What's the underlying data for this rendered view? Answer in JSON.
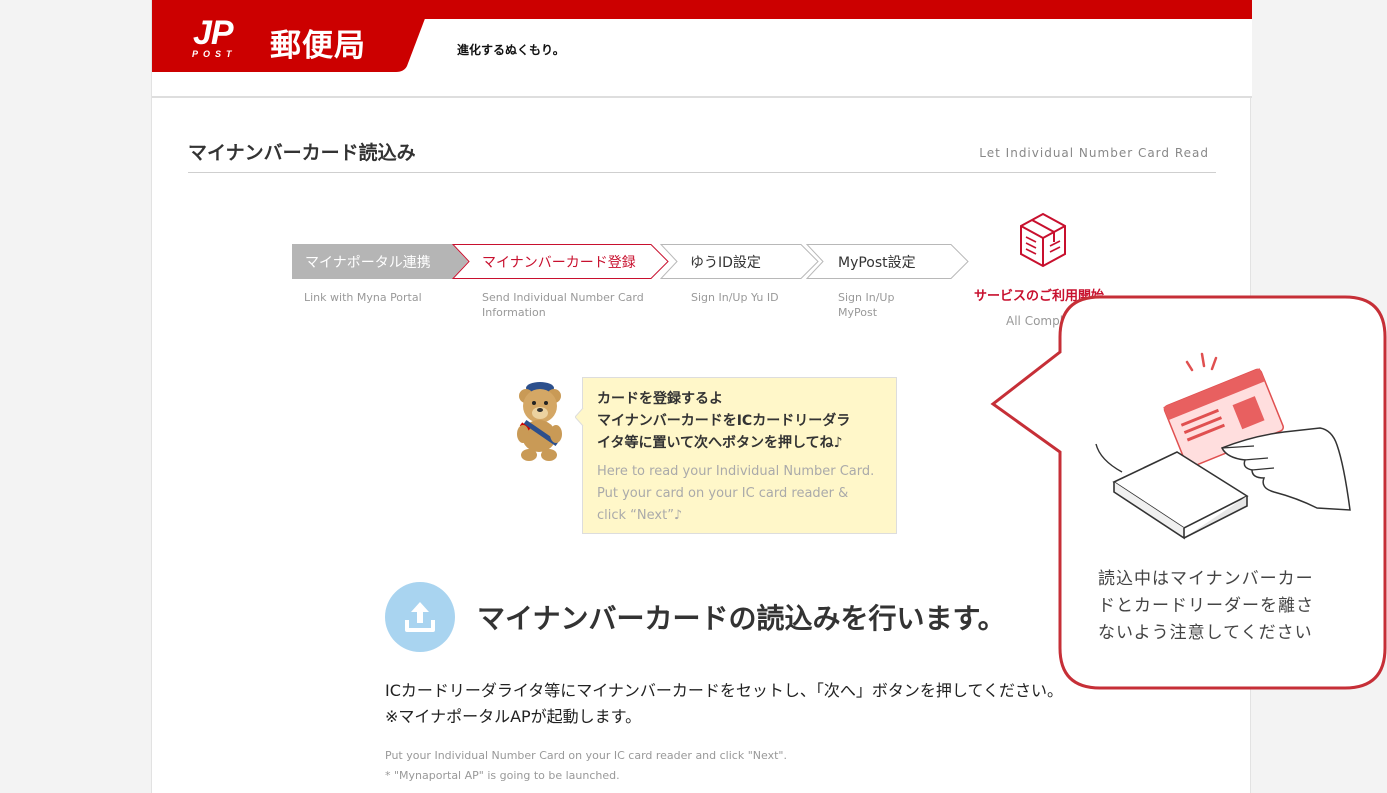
{
  "header": {
    "logo_mark": "JP",
    "logo_post": "POST",
    "logo_text": "郵便局",
    "tagline": "進化するぬくもり。"
  },
  "colors": {
    "brand_red": "#cc0000",
    "step_done_bg": "#b5b5b5",
    "accent_red": "#c8102e",
    "hint_bg": "#fff7c9",
    "upload_blue": "#a9d4f0"
  },
  "page": {
    "title": "マイナンバーカード読込み",
    "title_en": "Let Individual Number Card Read"
  },
  "steps": [
    {
      "label": "マイナポータル連携",
      "en": "Link with Myna Portal",
      "state": "done"
    },
    {
      "label": "マイナンバーカード登録",
      "en": "Send Individual Number Card\nInformation",
      "state": "current"
    },
    {
      "label": "ゆうID設定",
      "en": "Sign In/Up Yu ID",
      "state": "pending"
    },
    {
      "label": "MyPost設定",
      "en": "Sign In/Up\nMyPost",
      "state": "pending"
    }
  ],
  "final_step": {
    "label": "サービスのご利用開始",
    "en": "All Complete",
    "icon": "package-icon"
  },
  "hint": {
    "jp": "カードを登録するよ\nマイナンバーカードをICカードリーダラ\nイタ等に置いて次へボタンを押してね♪",
    "en": "Here to read your Individual Number Card.\nPut your card on your IC card reader &\nclick “Next”♪"
  },
  "main": {
    "heading": "マイナンバーカードの読込みを行います。",
    "instructions_jp": "ICカードリーダライタ等にマイナンバーカードをセットし、「次へ」ボタンを押してください。\n※マイナポータルAPが起動します。",
    "instructions_en": "Put your Individual Number Card on your IC card reader and click \"Next\".\n* \"Mynaportal AP\" is going to be launched."
  },
  "callout": {
    "text": "読込中はマイナンバーカー\nドとカードリーダーを離さ\nないよう注意してください"
  }
}
